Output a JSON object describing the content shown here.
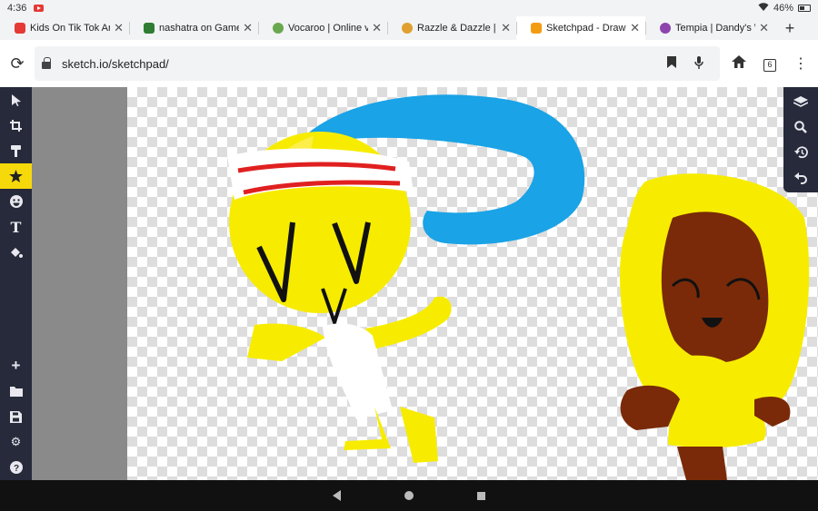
{
  "status": {
    "time": "4:36",
    "battery": "46%"
  },
  "tabs": [
    {
      "title": "Kids On Tik Tok Are Fu",
      "favicon_color": "#e53935",
      "icon": "youtube-icon"
    },
    {
      "title": "nashatra on Game Jolt",
      "favicon_color": "#2f7d32",
      "icon": "gamejolt-icon"
    },
    {
      "title": "Vocaroo | Online voice",
      "favicon_color": "#6aa84f",
      "icon": "vocaroo-icon"
    },
    {
      "title": "Razzle & Dazzle | Dand",
      "favicon_color": "#e0a030",
      "icon": "fandom-icon"
    },
    {
      "title": "Sketchpad - Draw, Crea",
      "favicon_color": "#f39c12",
      "icon": "sketchpad-icon",
      "active": true
    },
    {
      "title": "Tempia | Dandy's Worl",
      "favicon_color": "#8e44ad",
      "icon": "fandom-icon"
    }
  ],
  "toolbar": {
    "url": "sketch.io/sketchpad/",
    "tab_count": "6"
  },
  "left_tools": [
    "select-tool",
    "crop-tool",
    "brush-tool",
    "stamp-tool",
    "emoji-tool",
    "text-tool",
    "fill-tool"
  ],
  "left_tools_bottom": [
    "add-button",
    "open-folder-button",
    "save-button",
    "settings-button",
    "help-button"
  ],
  "right_tools": [
    "layers-button",
    "zoom-button",
    "history-button",
    "undo-button"
  ],
  "colors": {
    "sidebar": "#262a3a",
    "accent": "#f5d90a"
  }
}
